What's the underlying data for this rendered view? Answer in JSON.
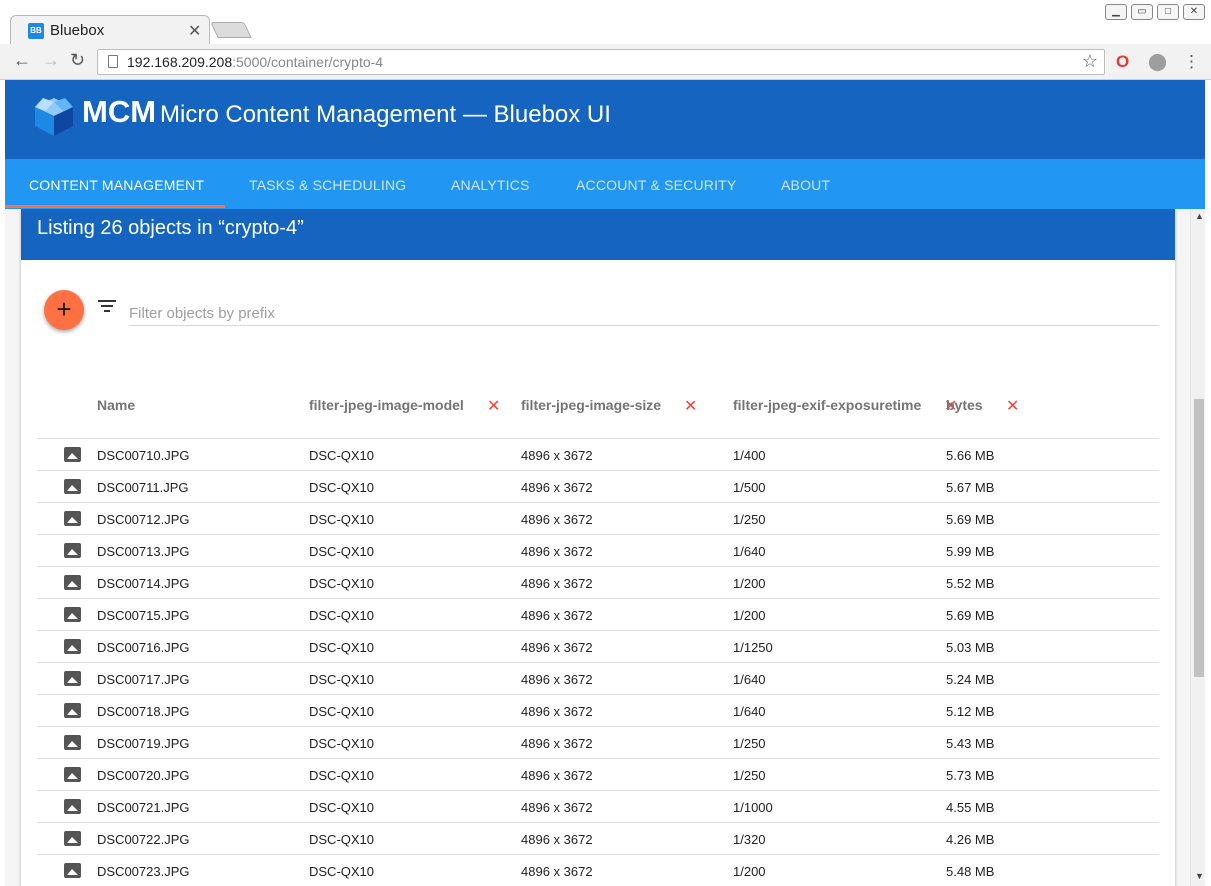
{
  "browser": {
    "tab_title": "Bluebox",
    "tab_favicon": "BB",
    "url_host": "192.168.209.208",
    "url_rest": ":5000/container/crypto-4"
  },
  "app": {
    "brand_bold": "MCM",
    "brand_title": "Micro Content Management — Bluebox UI",
    "header_color": "#1565c0",
    "nav_color": "#2196f3",
    "accent_color": "#ff7043"
  },
  "nav": {
    "items": [
      {
        "label": "CONTENT MANAGEMENT",
        "active": true
      },
      {
        "label": "TASKS & SCHEDULING",
        "active": false
      },
      {
        "label": "ANALYTICS",
        "active": false
      },
      {
        "label": "ACCOUNT & SECURITY",
        "active": false
      },
      {
        "label": "ABOUT",
        "active": false
      }
    ]
  },
  "listing": {
    "title": "Listing 26 objects in “crypto-4”",
    "filter_placeholder": "Filter objects by prefix",
    "columns": [
      "Name",
      "filter-jpeg-image-model",
      "filter-jpeg-image-size",
      "filter-jpeg-exif-exposuretime",
      "bytes"
    ],
    "rows": [
      {
        "name": "DSC00710.JPG",
        "model": "DSC-QX10",
        "size": "4896 x 3672",
        "exposure": "1/400",
        "bytes": "5.66 MB"
      },
      {
        "name": "DSC00711.JPG",
        "model": "DSC-QX10",
        "size": "4896 x 3672",
        "exposure": "1/500",
        "bytes": "5.67 MB"
      },
      {
        "name": "DSC00712.JPG",
        "model": "DSC-QX10",
        "size": "4896 x 3672",
        "exposure": "1/250",
        "bytes": "5.69 MB"
      },
      {
        "name": "DSC00713.JPG",
        "model": "DSC-QX10",
        "size": "4896 x 3672",
        "exposure": "1/640",
        "bytes": "5.99 MB"
      },
      {
        "name": "DSC00714.JPG",
        "model": "DSC-QX10",
        "size": "4896 x 3672",
        "exposure": "1/200",
        "bytes": "5.52 MB"
      },
      {
        "name": "DSC00715.JPG",
        "model": "DSC-QX10",
        "size": "4896 x 3672",
        "exposure": "1/200",
        "bytes": "5.69 MB"
      },
      {
        "name": "DSC00716.JPG",
        "model": "DSC-QX10",
        "size": "4896 x 3672",
        "exposure": "1/1250",
        "bytes": "5.03 MB"
      },
      {
        "name": "DSC00717.JPG",
        "model": "DSC-QX10",
        "size": "4896 x 3672",
        "exposure": "1/640",
        "bytes": "5.24 MB"
      },
      {
        "name": "DSC00718.JPG",
        "model": "DSC-QX10",
        "size": "4896 x 3672",
        "exposure": "1/640",
        "bytes": "5.12 MB"
      },
      {
        "name": "DSC00719.JPG",
        "model": "DSC-QX10",
        "size": "4896 x 3672",
        "exposure": "1/250",
        "bytes": "5.43 MB"
      },
      {
        "name": "DSC00720.JPG",
        "model": "DSC-QX10",
        "size": "4896 x 3672",
        "exposure": "1/250",
        "bytes": "5.73 MB"
      },
      {
        "name": "DSC00721.JPG",
        "model": "DSC-QX10",
        "size": "4896 x 3672",
        "exposure": "1/1000",
        "bytes": "4.55 MB"
      },
      {
        "name": "DSC00722.JPG",
        "model": "DSC-QX10",
        "size": "4896 x 3672",
        "exposure": "1/320",
        "bytes": "4.26 MB"
      },
      {
        "name": "DSC00723.JPG",
        "model": "DSC-QX10",
        "size": "4896 x 3672",
        "exposure": "1/200",
        "bytes": "5.48 MB"
      }
    ]
  }
}
